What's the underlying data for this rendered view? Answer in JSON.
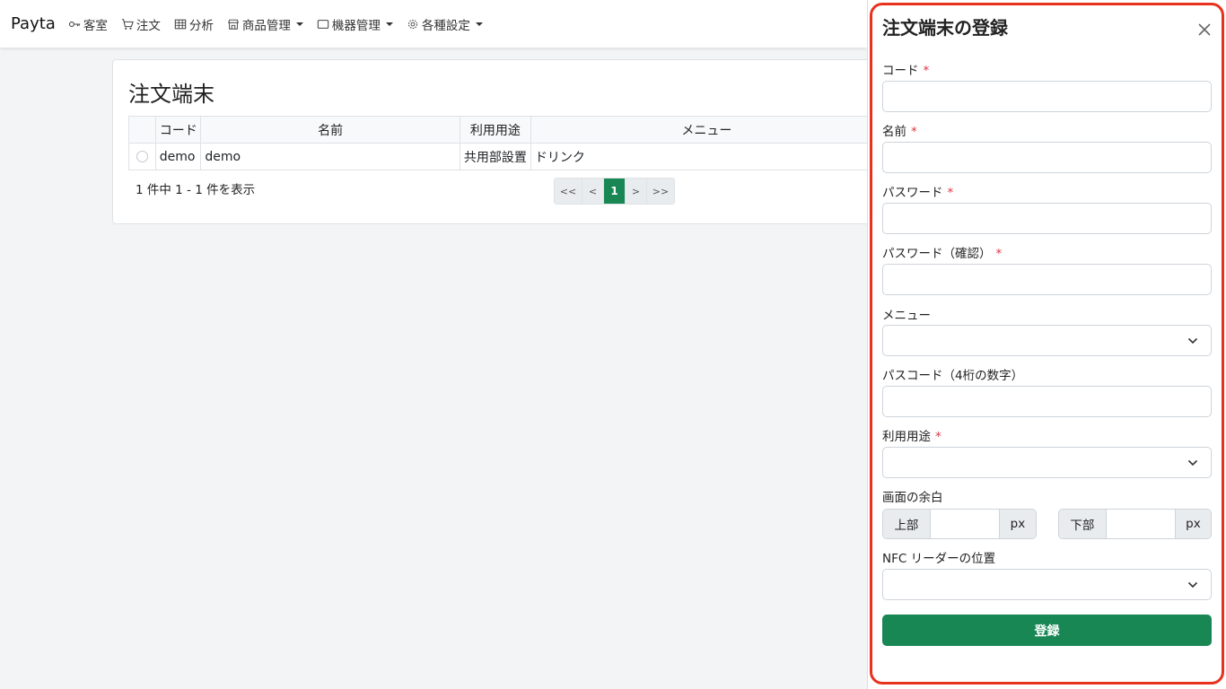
{
  "nav": {
    "brand": "Payta",
    "items": [
      {
        "label": "客室",
        "icon": "key-icon",
        "dropdown": false
      },
      {
        "label": "注文",
        "icon": "cart-icon",
        "dropdown": false
      },
      {
        "label": "分析",
        "icon": "table-icon",
        "dropdown": false
      },
      {
        "label": "商品管理",
        "icon": "shop-icon",
        "dropdown": true
      },
      {
        "label": "機器管理",
        "icon": "tablet-icon",
        "dropdown": true
      },
      {
        "label": "各種設定",
        "icon": "gear-icon",
        "dropdown": true
      }
    ]
  },
  "main": {
    "title": "注文端末",
    "table": {
      "headers": [
        "",
        "コード",
        "名前",
        "利用用途",
        "メニュー"
      ],
      "rows": [
        {
          "code": "demo",
          "name": "demo",
          "usage": "共用部設置",
          "menu": "ドリンク"
        }
      ]
    },
    "summary": "1 件中 1 - 1 件を表示",
    "pagination": {
      "first": "<<",
      "prev": "<",
      "current": "1",
      "next": ">",
      "last": ">>"
    }
  },
  "panel": {
    "title": "注文端末の登録",
    "required_mark": "*",
    "fields": {
      "code": {
        "label": "コード",
        "value": ""
      },
      "name": {
        "label": "名前",
        "value": ""
      },
      "password": {
        "label": "パスワード",
        "value": ""
      },
      "password_confirm": {
        "label": "パスワード（確認）",
        "value": ""
      },
      "menu": {
        "label": "メニュー",
        "selected": ""
      },
      "passcode": {
        "label": "パスコード（4桁の数字）",
        "value": ""
      },
      "usage": {
        "label": "利用用途",
        "selected": ""
      },
      "margin": {
        "label": "画面の余白",
        "top_label": "上部",
        "bottom_label": "下部",
        "unit": "px",
        "top_value": "",
        "bottom_value": ""
      },
      "nfc_position": {
        "label": "NFC リーダーの位置",
        "selected": ""
      }
    },
    "submit_label": "登録"
  },
  "colors": {
    "primary": "#198754",
    "highlight": "#e8321d",
    "required": "#dc3545"
  }
}
